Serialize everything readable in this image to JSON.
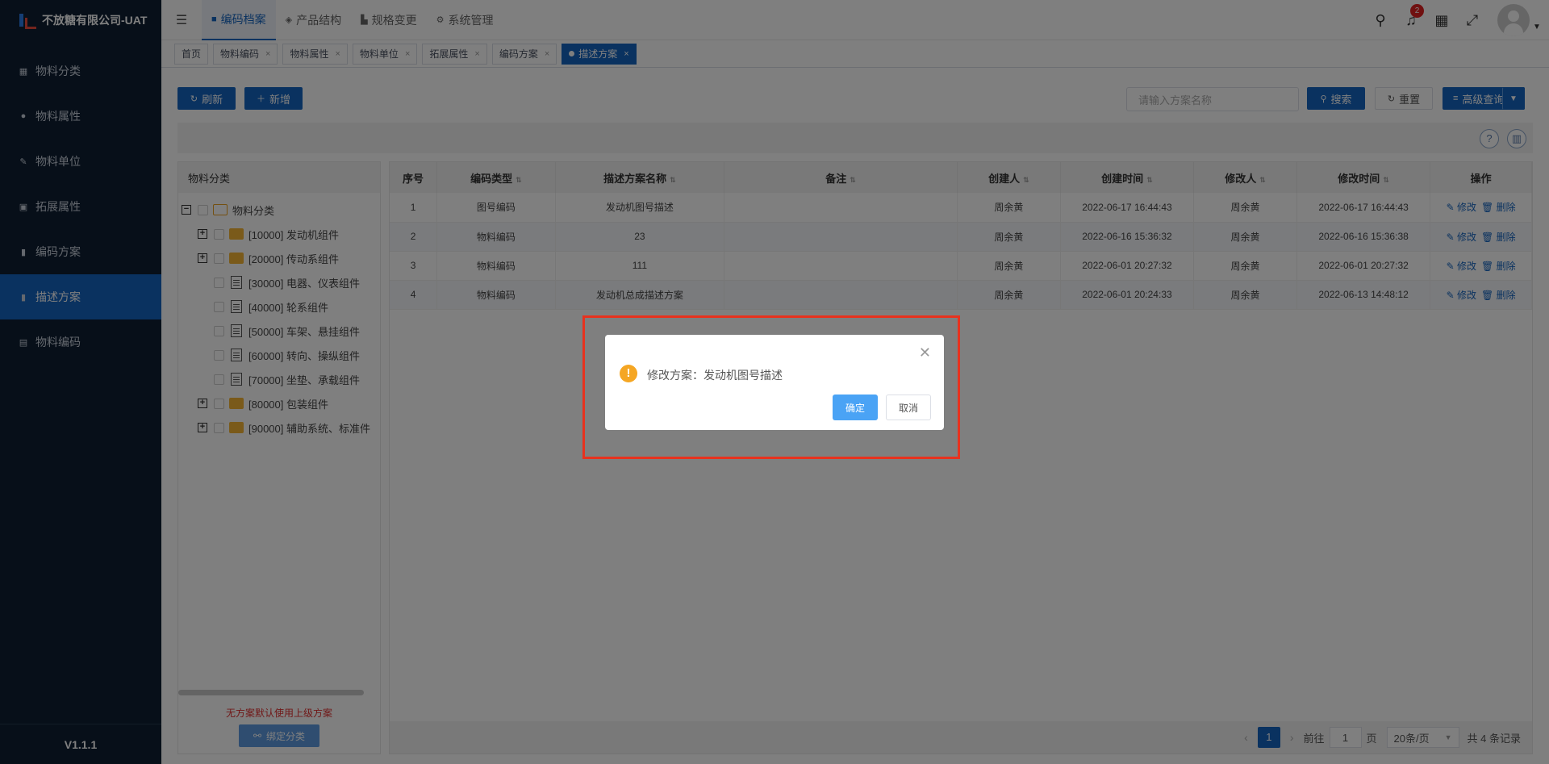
{
  "app": {
    "title": "不放糖有限公司-UAT",
    "version": "V1.1.1"
  },
  "sidebar": {
    "items": [
      {
        "label": "物料分类",
        "icon": "grid-icon"
      },
      {
        "label": "物料属性",
        "icon": "info-icon"
      },
      {
        "label": "物料单位",
        "icon": "pen-icon"
      },
      {
        "label": "拓展属性",
        "icon": "image-icon"
      },
      {
        "label": "编码方案",
        "icon": "book-icon"
      },
      {
        "label": "描述方案",
        "icon": "book-icon",
        "active": true
      },
      {
        "label": "物料编码",
        "icon": "doc-icon"
      }
    ]
  },
  "topnav": {
    "items": [
      {
        "label": "编码档案",
        "active": true
      },
      {
        "label": "产品结构"
      },
      {
        "label": "规格变更"
      },
      {
        "label": "系统管理"
      }
    ],
    "notification_count": "2"
  },
  "tabs": [
    "首页",
    "物料编码",
    "物料属性",
    "物料单位",
    "拓展属性",
    "编码方案",
    "描述方案"
  ],
  "toolbar": {
    "refresh_label": "刷新",
    "add_label": "新增",
    "search_placeholder": "请输入方案名称",
    "search_label": "搜索",
    "reset_label": "重置",
    "advanced_label": "高级查询"
  },
  "tree": {
    "header": "物料分类",
    "root": "物料分类",
    "nodes": [
      {
        "label": "[10000] 发动机组件",
        "type": "folder",
        "expandable": true
      },
      {
        "label": "[20000] 传动系组件",
        "type": "folder",
        "expandable": true
      },
      {
        "label": "[30000] 电器、仪表组件",
        "type": "doc",
        "expandable": false
      },
      {
        "label": "[40000] 轮系组件",
        "type": "doc",
        "expandable": false
      },
      {
        "label": "[50000] 车架、悬挂组件",
        "type": "doc",
        "expandable": false
      },
      {
        "label": "[60000] 转向、操纵组件",
        "type": "doc",
        "expandable": false
      },
      {
        "label": "[70000] 坐垫、承载组件",
        "type": "doc",
        "expandable": false
      },
      {
        "label": "[80000] 包装组件",
        "type": "folder",
        "expandable": true
      },
      {
        "label": "[90000] 辅助系统、标准件",
        "type": "folder",
        "expandable": true
      }
    ],
    "note": "无方案默认使用上级方案",
    "bind_label": "绑定分类"
  },
  "table": {
    "columns": [
      "序号",
      "编码类型",
      "描述方案名称",
      "备注",
      "创建人",
      "创建时间",
      "修改人",
      "修改时间",
      "操作"
    ],
    "rows": [
      [
        "1",
        "图号编码",
        "发动机图号描述",
        "",
        "周余黄",
        "2022-06-17 16:44:43",
        "周余黄",
        "2022-06-17 16:44:43"
      ],
      [
        "2",
        "物料编码",
        "23",
        "",
        "周余黄",
        "2022-06-16 15:36:32",
        "周余黄",
        "2022-06-16 15:36:38"
      ],
      [
        "3",
        "物料编码",
        "111",
        "",
        "周余黄",
        "2022-06-01 20:27:32",
        "周余黄",
        "2022-06-01 20:27:32"
      ],
      [
        "4",
        "物料编码",
        "发动机总成描述方案",
        "",
        "周余黄",
        "2022-06-01 20:24:33",
        "周余黄",
        "2022-06-13 14:48:12"
      ]
    ],
    "edit_label": "修改",
    "delete_label": "删除"
  },
  "pager": {
    "current": "1",
    "goto_label": "前往",
    "goto_value": "1",
    "page_unit": "页",
    "page_size": "20条/页",
    "total": "共 4 条记录"
  },
  "dialog": {
    "message": "修改方案：发动机图号描述",
    "ok_label": "确定",
    "cancel_label": "取消"
  }
}
